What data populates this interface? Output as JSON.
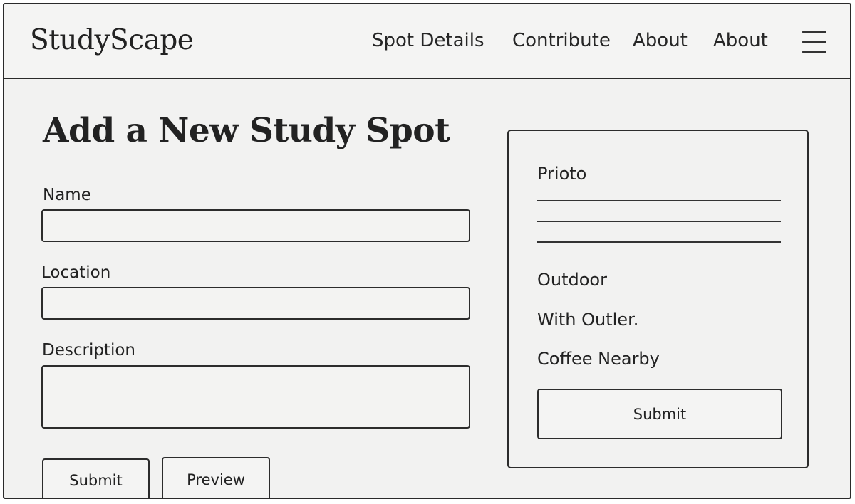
{
  "app": {
    "title": "StudyScape"
  },
  "nav": {
    "items": [
      {
        "label": "Spot Details"
      },
      {
        "label": "Contribute"
      },
      {
        "label": "About"
      },
      {
        "label": "About"
      }
    ],
    "menu_icon": "hamburger-menu-icon"
  },
  "form": {
    "title": "Add a New Study Spot",
    "fields": [
      {
        "label": "Name",
        "value": "",
        "placeholder": ""
      },
      {
        "label": "Location",
        "value": "",
        "placeholder": ""
      },
      {
        "label": "Description",
        "value": "",
        "placeholder": ""
      }
    ],
    "submit_label": "Submit",
    "preview_label": "Preview"
  },
  "panel": {
    "title": "Prioto",
    "items": [
      {
        "label": "Outdoor"
      },
      {
        "label": "With Outler."
      },
      {
        "label": "Coffee Nearby"
      }
    ],
    "submit_label": "Submit"
  }
}
